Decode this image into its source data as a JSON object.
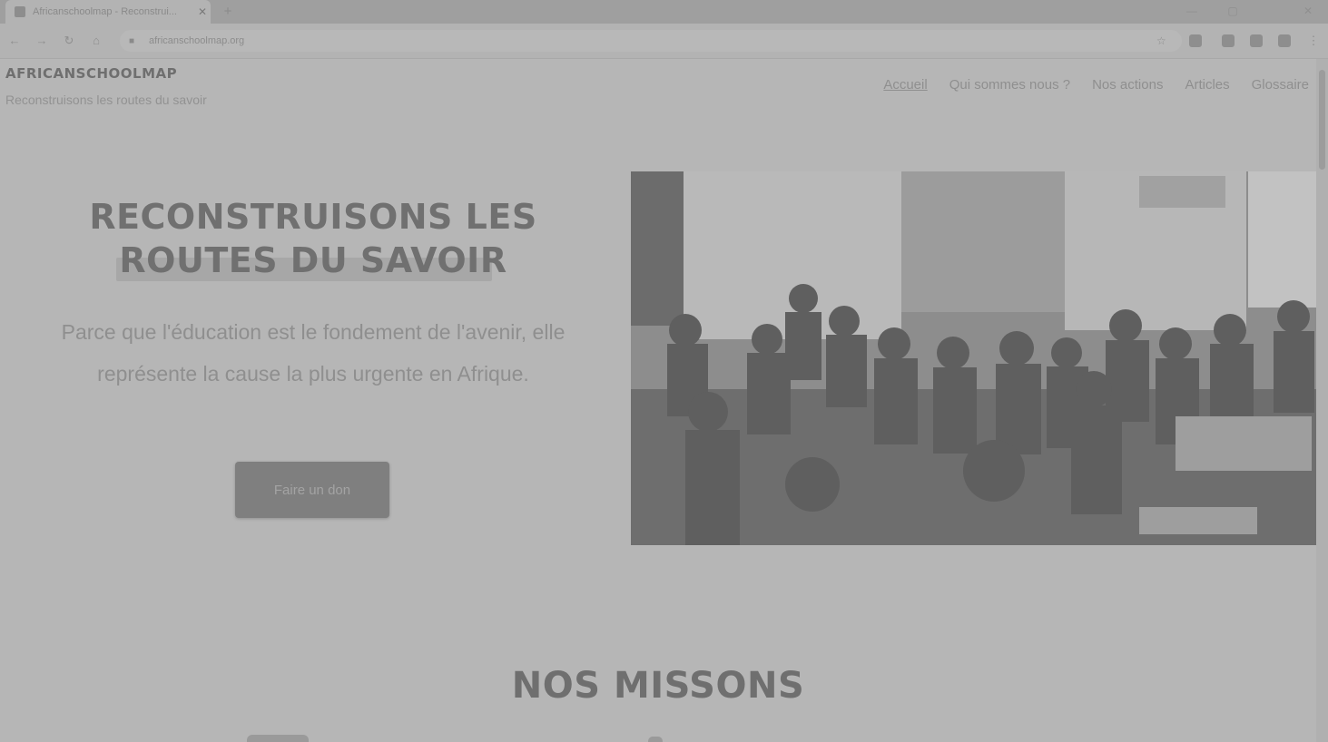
{
  "browser": {
    "tab_title": "Africanschoolmap - Reconstrui...",
    "tab_close": "✕",
    "new_tab": "+",
    "url": "africanschoolmap.org",
    "window_controls": [
      "—",
      "▢",
      "✕"
    ]
  },
  "site": {
    "title": "AFRICANSCHOOLMAP",
    "tagline": "Reconstruisons les routes du savoir"
  },
  "nav": {
    "items": [
      "Accueil",
      "Qui sommes nous ?",
      "Nos actions",
      "Articles",
      "Glossaire"
    ],
    "active_index": 0
  },
  "hero": {
    "heading": "RECONSTRUISONS LES ROUTES DU SAVOIR",
    "text": "Parce que l'éducation est le fondement de l'avenir, elle représente la cause la plus urgente en Afrique.",
    "button_label": "Faire un don",
    "image_alt": "Classroom of students in black and white"
  },
  "missions": {
    "heading": "NOS MISSONS"
  },
  "colors": {
    "overlay_gray": "#b6b6b6",
    "button_gray": "#7f7f7f",
    "heading_gray": "#707070"
  }
}
